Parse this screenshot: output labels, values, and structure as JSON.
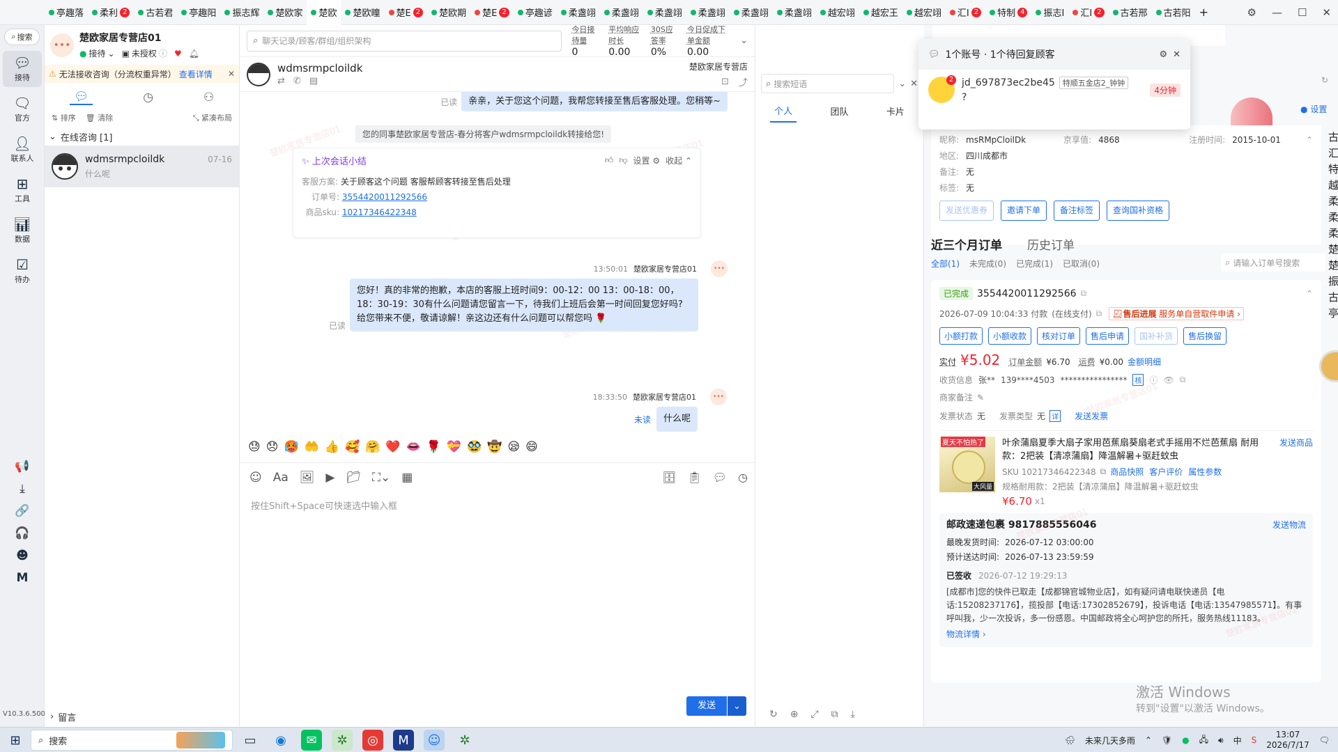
{
  "tabs": [
    {
      "label": "亭趣落",
      "color": "#12b76a"
    },
    {
      "label": "柔利",
      "color": "#12b76a",
      "badge": "2"
    },
    {
      "label": "古若君",
      "color": "#12b76a"
    },
    {
      "label": "亭趣阳",
      "color": "#12b76a"
    },
    {
      "label": "振志辉",
      "color": "#12b76a"
    },
    {
      "label": "楚欧家",
      "color": "#12b76a"
    },
    {
      "label": "楚欧",
      "color": "#12b76a",
      "active": true
    },
    {
      "label": "楚欧瞳",
      "color": "#12b76a"
    },
    {
      "label": "楚E",
      "color": "#ef4444",
      "badge": "2"
    },
    {
      "label": "楚欧期",
      "color": "#12b76a"
    },
    {
      "label": "楚E",
      "color": "#ef4444",
      "badge": "2"
    },
    {
      "label": "亭趣谚",
      "color": "#12b76a"
    },
    {
      "label": "柔盏翊",
      "color": "#12b76a"
    },
    {
      "label": "柔盏翊",
      "color": "#12b76a"
    },
    {
      "label": "柔盏翊",
      "color": "#12b76a"
    },
    {
      "label": "柔盏翊",
      "color": "#12b76a"
    },
    {
      "label": "柔盏翊",
      "color": "#12b76a"
    },
    {
      "label": "柔盏翊",
      "color": "#12b76a"
    },
    {
      "label": "越宏翊",
      "color": "#12b76a"
    },
    {
      "label": "越宏王",
      "color": "#12b76a"
    },
    {
      "label": "越宏翊",
      "color": "#12b76a"
    },
    {
      "label": "汇I",
      "color": "#ef4444",
      "badge": "2"
    },
    {
      "label": "特制",
      "color": "#12b76a",
      "badge": "4"
    },
    {
      "label": "振志I",
      "color": "#12b76a"
    },
    {
      "label": "汇I",
      "color": "#ef4444",
      "badge": "2"
    },
    {
      "label": "古若邢",
      "color": "#12b76a"
    },
    {
      "label": "古若阳",
      "color": "#12b76a"
    }
  ],
  "rail": {
    "search": "搜索",
    "items": [
      {
        "label": "接待",
        "icon": "chat-icon",
        "active": true
      },
      {
        "label": "官方",
        "icon": "official-icon"
      },
      {
        "label": "联系人",
        "icon": "contacts-icon"
      },
      {
        "label": "工具",
        "icon": "tools-icon"
      },
      {
        "label": "数据",
        "icon": "data-icon"
      },
      {
        "label": "待办",
        "icon": "todo-icon"
      }
    ],
    "version": "V10.3.6.500"
  },
  "shop": {
    "name": "楚欧家居专营店01",
    "status": "接待",
    "auth": "未授权",
    "warning": "无法接收咨询（分流权重异常）",
    "warning_link": "查看详情",
    "sort": "排序",
    "clear": "清除",
    "layout": "紧凑布局",
    "group": "在线咨询 [1]",
    "leave_msg": "留言"
  },
  "session": {
    "name": "wdmsrmpcloildk",
    "preview": "什么呢",
    "date": "07-16"
  },
  "search_placeholder": "聊天记录/顾客/群组/组织架构",
  "stats": [
    {
      "label": "今日接待量",
      "value": "0"
    },
    {
      "label": "平均响应时长",
      "value": "0.00"
    },
    {
      "label": "30S应答率",
      "value": "0%"
    },
    {
      "label": "今日促成下单金额",
      "value": "0.00"
    }
  ],
  "chat": {
    "customer": "wdmsrmpcloildk",
    "store": "楚欧家居专营店",
    "msg1": "亲亲，关于您这个问题，我帮您转接至售后客服处理。您稍等~",
    "msg1_status": "已读",
    "system": "您的同事楚欧家居专营店-春分将客户wdmsrmpcloildk转接给您!",
    "summary_title": "上次会话小结",
    "summary_settings": "设置",
    "summary_collapse": "收起",
    "summary_plan_label": "客服方案:",
    "summary_plan": "关于顾客这个问题 客服帮顾客转接至售后处理",
    "summary_order_label": "订单号:",
    "summary_order": "3554420011292566",
    "summary_sku_label": "商品sku:",
    "summary_sku": "10217346422348",
    "msg2_time": "13:50:01",
    "msg2_sender": "楚欧家居专营店01",
    "msg2": "您好！真的非常的抱歉，本店的客服上班时间9：00-12：00 13：00-18：00，18：30-19：30有什么问题请您留言一下，待我们上班后会第一时间回复您好吗?给您带来不便，敬请谅解！亲这边还有什么问题可以帮您吗",
    "msg2_status": "已读",
    "msg3_time": "18:33:50",
    "msg3_sender": "楚欧家居专营店01",
    "msg3": "什么呢",
    "msg3_status": "未读",
    "emojis": [
      "😓",
      "😞",
      "🥵",
      "🤲",
      "👍",
      "🥰",
      "🤗",
      "❤️",
      "👄",
      "🌹",
      "💝",
      "🥸",
      "🤠",
      "😪",
      "😄"
    ],
    "input_placeholder": "按住Shift+Space可快速选中输入框",
    "send": "发送"
  },
  "quick": {
    "placeholder": "搜索短语",
    "tabs": [
      "个人",
      "团队",
      "卡片"
    ]
  },
  "popup": {
    "title": "1个账号 · 1个待回复顾客",
    "user": "jd_697873ec2be45",
    "tag": "特顺五金店2_钟钟",
    "msg": "?",
    "time": "4分钟",
    "badge": "2"
  },
  "profile": {
    "nick_label": "昵称:",
    "nick": "msRMpCloilDk",
    "jx_label": "京享值:",
    "jx": "4868",
    "reg_label": "注册时间:",
    "reg": "2015-10-01",
    "region_label": "地区:",
    "region": "四川成都市",
    "note_label": "备注:",
    "note": "无",
    "tag_label": "标签:",
    "tag": "无",
    "settings": "设置",
    "buttons": [
      "发送优惠券",
      "邀请下单",
      "备注标签",
      "查询国补资格"
    ]
  },
  "orders": {
    "tab_recent": "近三个月订单",
    "tab_history": "历史订单",
    "filters": [
      "全部(1)",
      "未完成(0)",
      "已完成(1)",
      "已取消(0)"
    ],
    "search_placeholder": "请输入订单号搜索",
    "status": "已完成",
    "order_id": "3554420011292566",
    "pay_time": "2026-07-09 10:04:33 付款",
    "pay_type": "(在线支付)",
    "aftersale": "售后进展",
    "aftersale_text": "服务单自营取件申请",
    "actions": [
      "小额打款",
      "小额收款",
      "核对订单",
      "售后申请",
      "国补补货",
      "售后换留"
    ],
    "paid_label": "实付",
    "paid": "¥5.02",
    "amount_label": "订单金额",
    "amount": "¥6.70",
    "ship_label": "运费",
    "ship": "¥0.00",
    "detail": "金额明细",
    "recv_label": "收货信息",
    "recv_name": "张**",
    "recv_phone": "139****4503",
    "recv_addr": "****************",
    "recv_tag": "核",
    "merchant_note_label": "商家备注",
    "invoice_status_label": "发票状态",
    "invoice_status": "无",
    "invoice_type_label": "发票类型",
    "invoice_type": "无",
    "invoice_tag": "详",
    "send_invoice": "发送发票",
    "product_title": "叶余蒲扇夏季大扇子家用芭蕉扇葵扇老式手摇用不烂芭蕉扇 耐用款：2把装【清凉蒲扇】降温解暑+驱赶蚊虫",
    "send_product": "发送商品",
    "product_img_text1": "夏天不怕热了",
    "product_img_text2": "大风量",
    "sku": "SKU 10217346422348",
    "sku_links": [
      "商品快照",
      "客户评价",
      "属性参数"
    ],
    "spec": "规格耐用款：2把装【清凉蒲扇】降温解暑+驱赶蚊虫",
    "price": "¥6.70",
    "qty": "x1",
    "pkg_title": "邮政速递包裹 9817885556046",
    "send_logistics": "发送物流",
    "latest_ship_label": "最晚发货时间:",
    "latest_ship": "2026-07-12 03:00:00",
    "eta_label": "预计送达时间:",
    "eta": "2026-07-13 23:59:59",
    "signed": "已签收",
    "signed_time": "2026-07-12 19:29:13",
    "logistics_text": "[成都市]您的快件已取走【成都锦官城物业店】，如有疑问请电联快递员【电话:15208237176】，揽投部【电话:17302852679】，投诉电话【电话:13547985571】。有事呼叫我，少一次投诉，多一份感恩。中国邮政将全心呵护您的所托，服务热线11183。",
    "logistics_detail": "物流详情"
  },
  "activate": {
    "line1": "激活 Windows",
    "line2": "转到\"设置\"以激活 Windows。"
  },
  "side_strip": [
    "古",
    "汇",
    "特",
    "越",
    "柔",
    "柔",
    "柔",
    "楚",
    "楚",
    "振",
    "古",
    "亭"
  ],
  "taskbar": {
    "search": "搜索",
    "weather": "未来几天多雨",
    "time": "13:07",
    "date": "2026/7/17",
    "ime": "中"
  },
  "watermark": "楚欧家居专营店01"
}
